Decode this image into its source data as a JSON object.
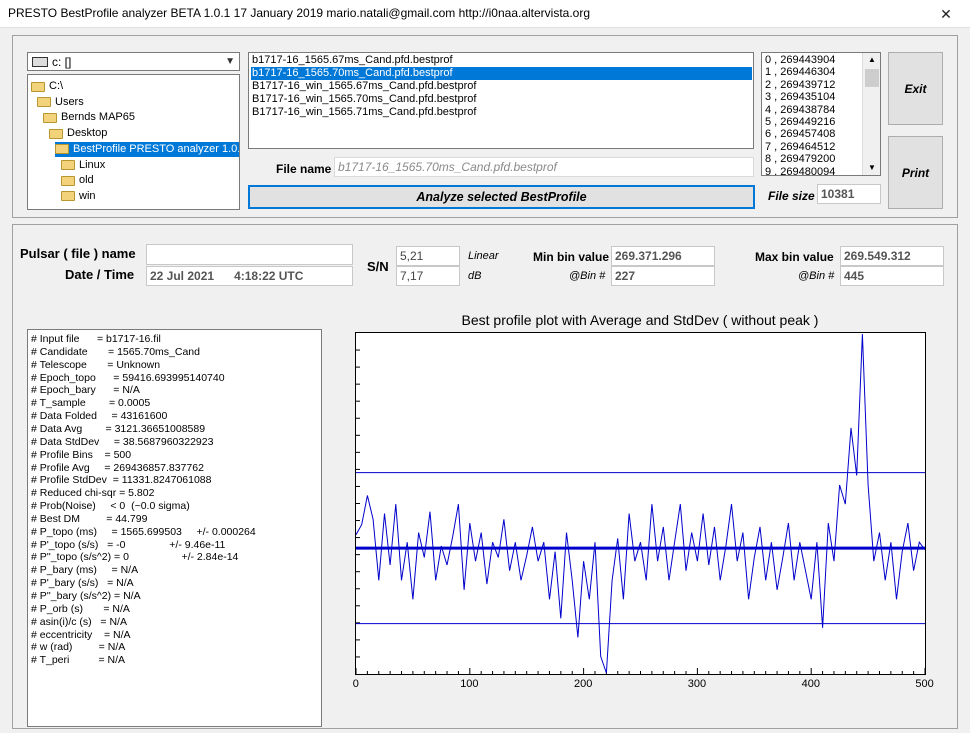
{
  "window": {
    "title": "PRESTO BestProfile analyzer BETA 1.0.1   17 January 2019        mario.natali@gmail.com        http://i0naa.altervista.org",
    "close_glyph": "✕"
  },
  "drive": {
    "label": "c: []"
  },
  "dirs": [
    {
      "label": "C:\\",
      "level": 0
    },
    {
      "label": "Users",
      "level": 1
    },
    {
      "label": "Bernds MAP65",
      "level": 2
    },
    {
      "label": "Desktop",
      "level": 3
    },
    {
      "label": "BestProfile PRESTO analyzer 1.0.1.e",
      "level": 4,
      "selected": true
    },
    {
      "label": "Linux",
      "level": 5
    },
    {
      "label": "old",
      "level": 5
    },
    {
      "label": "win",
      "level": 5
    }
  ],
  "files": [
    {
      "label": "b1717-16_1565.67ms_Cand.pfd.bestprof"
    },
    {
      "label": "b1717-16_1565.70ms_Cand.pfd.bestprof",
      "selected": true
    },
    {
      "label": "B1717-16_win_1565.67ms_Cand.pfd.bestprof"
    },
    {
      "label": "B1717-16_win_1565.70ms_Cand.pfd.bestprof"
    },
    {
      "label": "B1717-16_win_1565.71ms_Cand.pfd.bestprof"
    }
  ],
  "numlist": [
    "0  ,  269443904",
    "1  ,  269446304",
    "2  ,  269439712",
    "3  ,  269435104",
    "4  ,  269438784",
    "5  ,  269449216",
    "6  ,  269457408",
    "7  ,  269464512",
    "8  ,  269479200",
    "9  ,  269480094"
  ],
  "buttons": {
    "exit": "Exit",
    "print": "Print",
    "analyze": "Analyze selected BestProfile"
  },
  "file_name": {
    "label": "File name",
    "value": "b1717-16_1565.70ms_Cand.pfd.bestprof"
  },
  "file_size": {
    "label": "File size",
    "value": "10381"
  },
  "pulsar": {
    "name_label": "Pulsar ( file ) name",
    "name_value": "",
    "datetime_label": "Date / Time",
    "date_value": "22 Jul 2021",
    "time_value": "4:18:22  UTC"
  },
  "sn": {
    "label": "S/N",
    "linear_value": "5,21",
    "linear_unit": "Linear",
    "db_value": "7,17",
    "db_unit": "dB"
  },
  "min_bin": {
    "label": "Min bin value",
    "value": "269.371.296",
    "bin_label": "@Bin #",
    "bin_value": "227"
  },
  "max_bin": {
    "label": "Max bin value",
    "value": "269.549.312",
    "bin_label": "@Bin #",
    "bin_value": "445"
  },
  "info_lines": [
    "# Input file      = b1717-16.fil",
    "# Candidate       = 1565.70ms_Cand",
    "# Telescope       = Unknown",
    "# Epoch_topo      = 59416.693995140740",
    "# Epoch_bary      = N/A",
    "# T_sample        = 0.0005",
    "# Data Folded     = 43161600",
    "# Data Avg        = 3121.36651008589",
    "# Data StdDev     = 38.5687960322923",
    "# Profile Bins    = 500",
    "# Profile Avg     = 269436857.837762",
    "# Profile StdDev  = 11331.8247061088",
    "# Reduced chi-sqr = 5.802",
    "# Prob(Noise)     < 0  (~0.0 sigma)",
    "# Best DM         = 44.799",
    "# P_topo (ms)     = 1565.699503     +/- 0.000264",
    "# P'_topo (s/s)   = -0               +/- 9.46e-11",
    "# P''_topo (s/s^2) = 0                  +/- 2.84e-14",
    "# P_bary (ms)     = N/A",
    "# P'_bary (s/s)   = N/A",
    "# P''_bary (s/s^2) = N/A",
    "# P_orb (s)       = N/A",
    "# asin(i)/c (s)   = N/A",
    "# eccentricity    = N/A",
    "# w (rad)         = N/A",
    "# T_peri          = N/A"
  ],
  "chart_data": {
    "type": "line",
    "title": "Best profile plot with  Average and StdDev ( without peak )",
    "xlim": [
      0,
      500
    ],
    "ylim": [
      269371296,
      269549312
    ],
    "xticks": [
      "0",
      "100",
      "200",
      "300",
      "400",
      "500"
    ],
    "average": 269436857.84,
    "stddev": 11331.82,
    "series_color": "#0000cc",
    "x": [
      0,
      5,
      10,
      15,
      20,
      25,
      30,
      35,
      40,
      45,
      50,
      55,
      60,
      65,
      70,
      75,
      80,
      85,
      90,
      95,
      100,
      105,
      110,
      115,
      120,
      125,
      130,
      135,
      140,
      145,
      150,
      155,
      160,
      165,
      170,
      175,
      180,
      185,
      190,
      195,
      200,
      205,
      210,
      215,
      220,
      225,
      230,
      235,
      240,
      245,
      250,
      255,
      260,
      265,
      270,
      275,
      280,
      285,
      290,
      295,
      300,
      305,
      310,
      315,
      320,
      325,
      330,
      335,
      340,
      345,
      350,
      355,
      360,
      365,
      370,
      375,
      380,
      385,
      390,
      395,
      400,
      405,
      410,
      415,
      420,
      425,
      430,
      435,
      440,
      445,
      450,
      455,
      460,
      465,
      470,
      475,
      480,
      485,
      490,
      495,
      500
    ],
    "y": [
      269443904,
      269449216,
      269464512,
      269452000,
      269420000,
      269455000,
      269428000,
      269460000,
      269420000,
      269440000,
      269410000,
      269445000,
      269432000,
      269456000,
      269420000,
      269438000,
      269428000,
      269443000,
      269460000,
      269415000,
      269450000,
      269430000,
      269445000,
      269418000,
      269440000,
      269432000,
      269452000,
      269425000,
      269440000,
      269420000,
      269433000,
      269448000,
      269430000,
      269440000,
      269410000,
      269435000,
      269400000,
      269445000,
      269420000,
      269390000,
      269430000,
      269410000,
      269440000,
      269380000,
      269371296,
      269420000,
      269442000,
      269410000,
      269455000,
      269430000,
      269440000,
      269420000,
      269460000,
      269430000,
      269448000,
      269420000,
      269440000,
      269460000,
      269425000,
      269445000,
      269430000,
      269455000,
      269428000,
      269448000,
      269420000,
      269438000,
      269460000,
      269430000,
      269445000,
      269410000,
      269432000,
      269448000,
      269420000,
      269440000,
      269415000,
      269432000,
      269450000,
      269420000,
      269440000,
      269425000,
      269410000,
      269440000,
      269395000,
      269450000,
      269430000,
      269470000,
      269460000,
      269500000,
      269475000,
      269549312,
      269470000,
      269430000,
      269445000,
      269420000,
      269440000,
      269410000,
      269435000,
      269450000,
      269425000,
      269440000,
      269436000
    ]
  }
}
